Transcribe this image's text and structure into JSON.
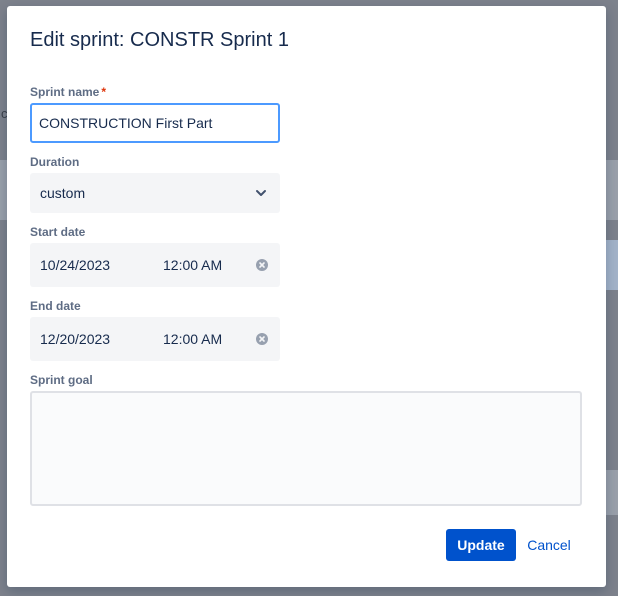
{
  "dialog": {
    "title": "Edit sprint: CONSTR Sprint 1",
    "sprint_name": {
      "label": "Sprint name",
      "required_mark": "*",
      "value": "CONSTRUCTION First Part"
    },
    "duration": {
      "label": "Duration",
      "value": "custom"
    },
    "start_date": {
      "label": "Start date",
      "date": "10/24/2023",
      "time": "12:00 AM"
    },
    "end_date": {
      "label": "End date",
      "date": "12/20/2023",
      "time": "12:00 AM"
    },
    "sprint_goal": {
      "label": "Sprint goal",
      "value": ""
    },
    "buttons": {
      "update": "Update",
      "cancel": "Cancel"
    }
  },
  "background": {
    "left_letter": "c"
  },
  "colors": {
    "primary": "#0052cc",
    "focus_border": "#4c9aff",
    "field_bg": "#f4f5f7",
    "text": "#172b4d",
    "label": "#5e6c84"
  },
  "icons": {
    "duration_chevron": "chevron-down-icon",
    "clear": "clear-icon"
  }
}
